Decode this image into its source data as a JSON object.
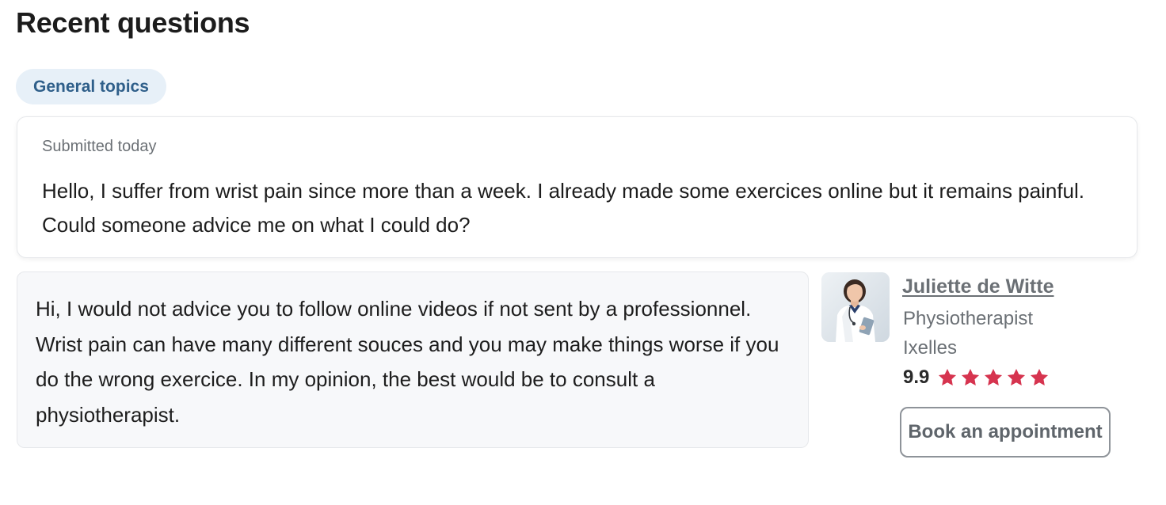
{
  "section": {
    "title": "Recent questions"
  },
  "filter": {
    "chip_label": "General topics"
  },
  "question": {
    "meta": "Submitted today",
    "text": "Hello, I suffer from wrist pain since more than a week. I already made some exercices online but it remains painful. Could someone advice me on what I could do?"
  },
  "answer": {
    "text": "Hi, I would not advice you to follow online videos if not sent by a professionnel. Wrist pain can have many different souces and you may make things worse if you do the wrong exercice. In my opinion, the best would be to consult a physiotherapist."
  },
  "doctor": {
    "name": "Juliette de Witte",
    "role": "Physiotherapist",
    "city": "Ixelles",
    "rating": "9.9",
    "stars": 5,
    "star_color": "#d6344f",
    "avatar_icon": "doctor-portrait"
  },
  "actions": {
    "book_label": "Book an appointment"
  }
}
